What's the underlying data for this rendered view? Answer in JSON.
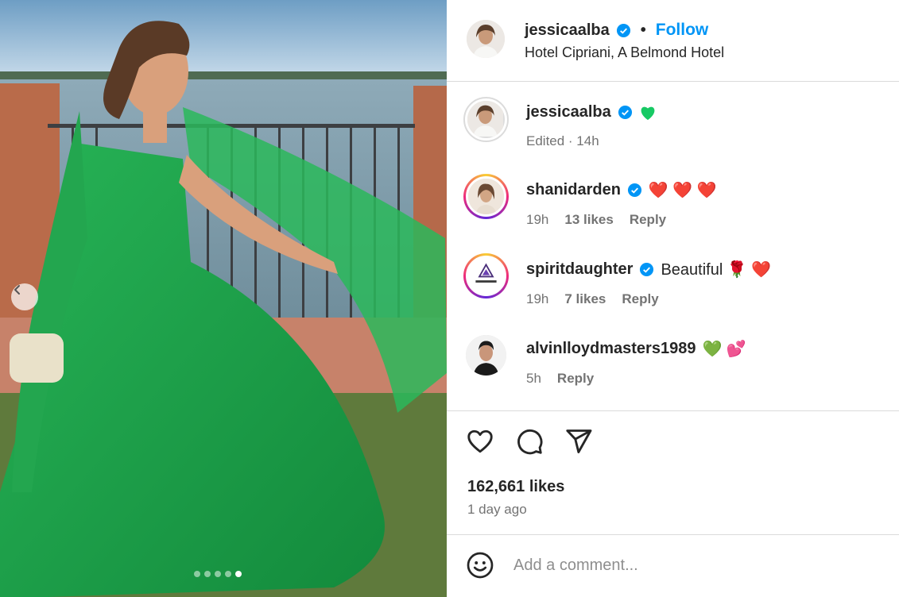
{
  "post": {
    "author": "jessicaalba",
    "follow_label": "Follow",
    "separator": "•",
    "location": "Hotel Cipriani, A Belmond Hotel",
    "caption_meta": "Edited · 14h",
    "likes": "162,661 likes",
    "date": "1 day ago",
    "carousel": {
      "count": 5,
      "active_index": 4
    }
  },
  "comments": [
    {
      "user": "shanidarden",
      "verified": true,
      "text": "❤️ ❤️ ❤️",
      "time": "19h",
      "likes": "13 likes",
      "reply": "Reply"
    },
    {
      "user": "spiritdaughter",
      "verified": true,
      "text": "Beautiful 🌹 ❤️",
      "time": "19h",
      "likes": "7 likes",
      "reply": "Reply"
    },
    {
      "user": "alvinlloydmasters1989",
      "verified": false,
      "text": "💚 💕",
      "time": "5h",
      "reply": "Reply"
    }
  ],
  "add_comment": {
    "placeholder": "Add a comment..."
  },
  "icons": {
    "verified": "verified-badge-icon",
    "like": "heart-icon",
    "comment": "speech-bubble-icon",
    "share": "paper-plane-icon",
    "emoji": "smiley-icon",
    "prev": "chevron-left-icon"
  },
  "colors": {
    "accent": "#0095f6",
    "verified": "#0095f6",
    "dress": "#1fa14a"
  }
}
